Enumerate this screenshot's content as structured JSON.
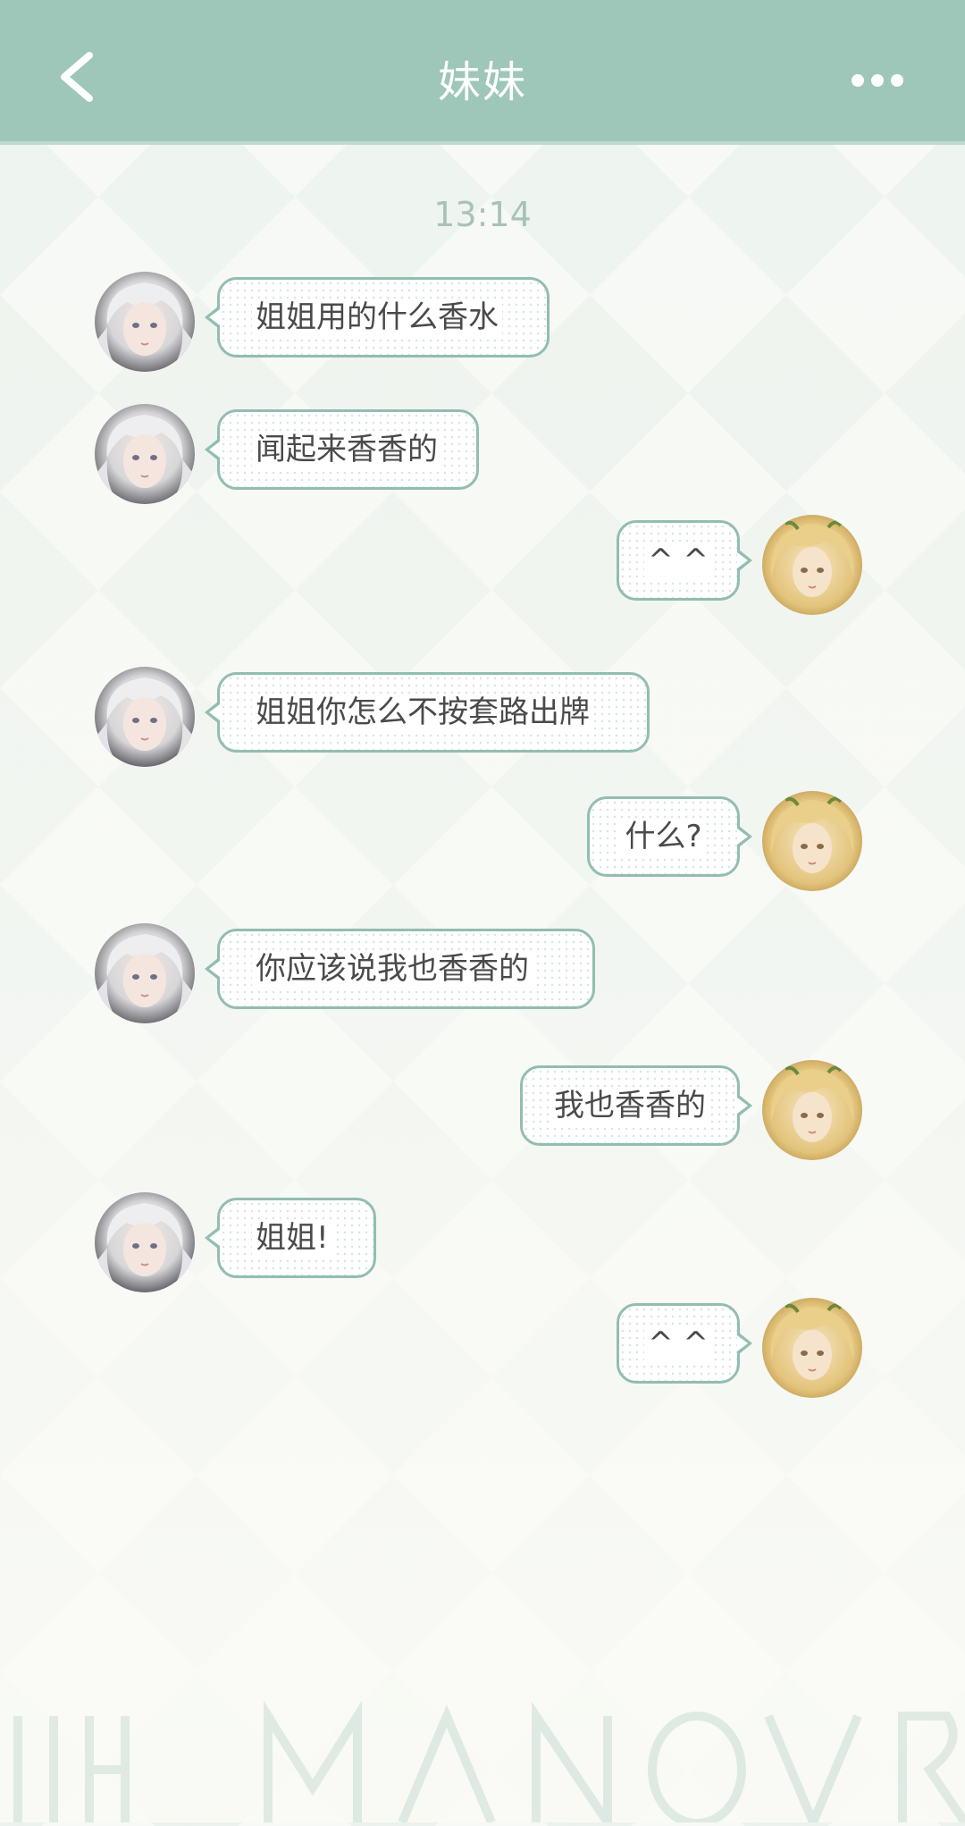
{
  "header": {
    "title": "妹妹",
    "back_icon": "chevron-left-icon",
    "more_icon": "more-horizontal-icon",
    "background_color": "#9ec6b9"
  },
  "timestamp": "13:14",
  "messages": [
    {
      "side": "left",
      "text": "姐姐用的什么香水"
    },
    {
      "side": "left",
      "text": "闻起来香香的"
    },
    {
      "side": "right",
      "text": "^ ^"
    },
    {
      "side": "left",
      "text": "姐姐你怎么不按套路出牌"
    },
    {
      "side": "right",
      "text": "什么?"
    },
    {
      "side": "left",
      "text": "你应该说我也香香的"
    },
    {
      "side": "right",
      "text": "我也香香的"
    },
    {
      "side": "left",
      "text": "姐姐!"
    },
    {
      "side": "right",
      "text": "^ ^"
    }
  ],
  "colors": {
    "bubble_border": "#93bdb1",
    "text": "#4a4a4a",
    "timestamp": "#a9c2b8"
  }
}
